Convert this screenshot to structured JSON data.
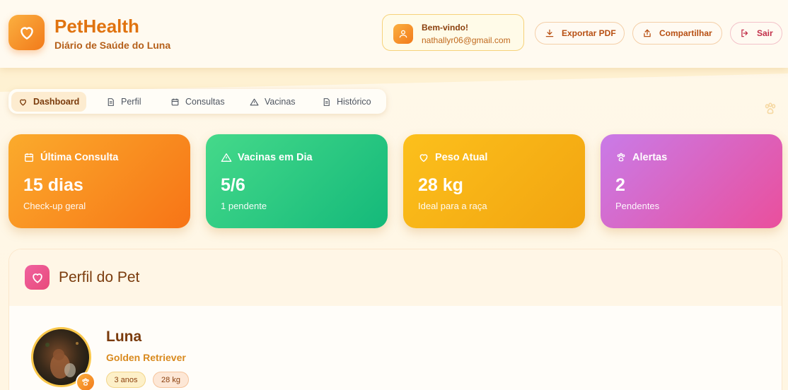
{
  "brand": {
    "title": "PetHealth",
    "subtitle": "Diário de Saúde do Luna",
    "logo_icon": "heart-icon"
  },
  "user": {
    "greeting": "Bem-vindo!",
    "email": "nathallyr06@gmail.com",
    "icon": "user-icon"
  },
  "header_buttons": {
    "export": "Exportar PDF",
    "share": "Compartilhar",
    "logout": "Sair"
  },
  "tabs": [
    {
      "label": "Dashboard",
      "icon": "heart-icon",
      "active": true
    },
    {
      "label": "Perfil",
      "icon": "document-icon",
      "active": false
    },
    {
      "label": "Consultas",
      "icon": "calendar-icon",
      "active": false
    },
    {
      "label": "Vacinas",
      "icon": "warning-icon",
      "active": false
    },
    {
      "label": "Histórico",
      "icon": "document-icon",
      "active": false
    }
  ],
  "stats": [
    {
      "title": "Última Consulta",
      "value": "15 dias",
      "note": "Check-up geral",
      "icon": "calendar-icon",
      "color": "#f77416"
    },
    {
      "title": "Vacinas em Dia",
      "value": "5/6",
      "note": "1 pendente",
      "icon": "warning-icon",
      "color": "#14b97a"
    },
    {
      "title": "Peso Atual",
      "value": "28 kg",
      "note": "Ideal para a raça",
      "icon": "heart-icon",
      "color": "#f2a410"
    },
    {
      "title": "Alertas",
      "value": "2",
      "note": "Pendentes",
      "icon": "paw-icon",
      "color": "#ea4f9c"
    }
  ],
  "profile": {
    "section_title": "Perfil do Pet",
    "name": "Luna",
    "breed": "Golden Retriever",
    "age": "3 anos",
    "weight": "28 kg"
  }
}
